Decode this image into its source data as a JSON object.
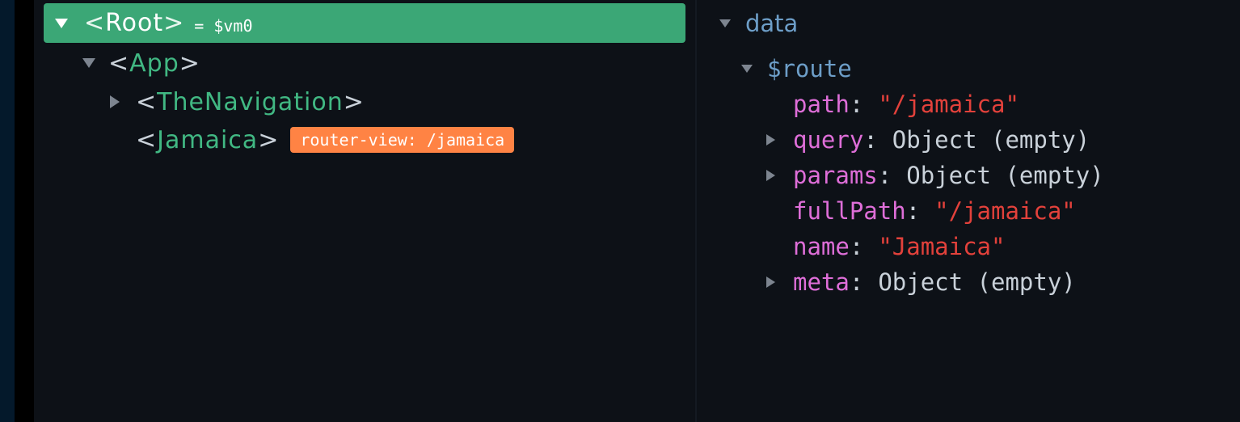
{
  "tree": {
    "root": {
      "open": "<",
      "name": "Root",
      "close": ">",
      "vm": "= $vm0"
    },
    "app": {
      "open": "<",
      "name": "App",
      "close": ">"
    },
    "nav": {
      "open": "<",
      "name": "TheNavigation",
      "close": ">"
    },
    "jamaica": {
      "open": "<",
      "name": "Jamaica",
      "close": ">",
      "badge": "router-view: /jamaica"
    }
  },
  "state": {
    "section": "data",
    "route": {
      "label": "$route",
      "props": [
        {
          "key": "path",
          "value": "\"/jamaica\""
        },
        {
          "key": "query",
          "value": "Object (empty)"
        },
        {
          "key": "params",
          "value": "Object (empty)"
        },
        {
          "key": "fullPath",
          "value": "\"/jamaica\""
        },
        {
          "key": "name",
          "value": "\"Jamaica\""
        },
        {
          "key": "meta",
          "value": "Object (empty)"
        }
      ]
    },
    "colon": ":"
  },
  "colors": {
    "selected_bg": "#3ba776",
    "component_name": "#41b883",
    "badge_bg": "#ff8344",
    "key": "#de6ed8",
    "string": "#e2413b",
    "section": "#6d9ec8"
  }
}
